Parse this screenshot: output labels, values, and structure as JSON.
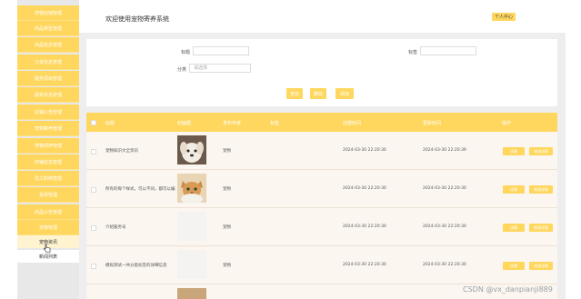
{
  "sidebar": {
    "items": [
      "宠物店铺管理",
      "商品类型管理",
      "商品信息管理",
      "订单信息管理",
      "服务项目管理",
      "服务信息管理",
      "店铺公告管理",
      "宠物寄养管理",
      "宠物领养管理",
      "商铺信息管理",
      "员工职称管理",
      "系统管理",
      "商品公告管理",
      "宠物管理"
    ],
    "sub_items": [
      "宠物资讯",
      "新闻列表"
    ]
  },
  "header": {
    "title": "欢迎使用宠物寄养系统",
    "user_center": "个人中心"
  },
  "search": {
    "fields": [
      {
        "label": "标题",
        "placeholder": ""
      },
      {
        "label": "标签",
        "placeholder": ""
      },
      {
        "label": "分类",
        "placeholder": "请选择"
      }
    ],
    "buttons": [
      "查找",
      "删除",
      "添加"
    ]
  },
  "table": {
    "columns": [
      "标题",
      "封面图",
      "发布作者",
      "标签",
      "创建时间",
      "更新时间",
      "操作"
    ],
    "rows": [
      {
        "title": "宠物知识大全资讯",
        "author": "宠物",
        "created": "2024-03-30 22:20:30",
        "updated": "2024-03-30 22:20:39",
        "has_image": true,
        "img": "puppy"
      },
      {
        "title": "所有的每个样式，可以不同，都可以编",
        "author": "宠物",
        "created": "2024-03-30 22:20:30",
        "updated": "2024-03-30 22:20:30",
        "has_image": true,
        "img": "kitten"
      },
      {
        "title": "介绍服务号",
        "author": "宠物",
        "created": "2024-03-30 22:20:30",
        "updated": "2024-03-30 22:20:30",
        "has_image": false,
        "img": ""
      },
      {
        "title": "模拟测试一共分类标签的详细信息",
        "author": "宠物",
        "created": "2024-03-30 22:20:30",
        "updated": "2024-03-30 22:20:30",
        "has_image": false,
        "img": ""
      }
    ],
    "actions": [
      "详情",
      "修改详情"
    ]
  },
  "watermark": "CSDN @vx_danpianji889",
  "colors": {
    "accent": "#ffd75e",
    "sidebar_bg": "#e8e8e8",
    "table_bg": "#fbf6f0"
  }
}
